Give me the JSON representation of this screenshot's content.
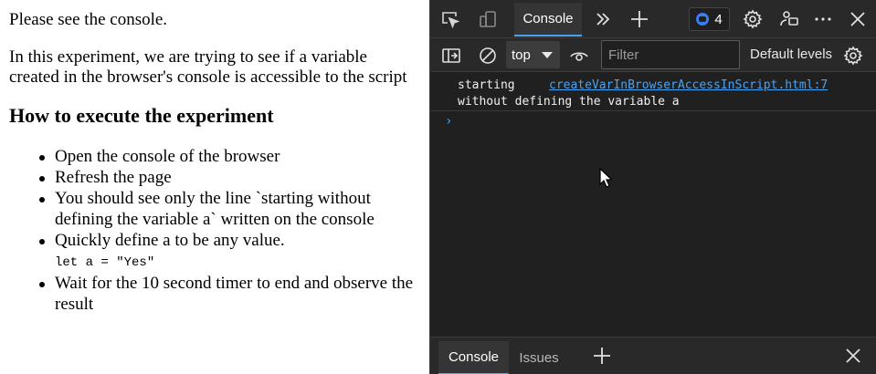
{
  "page": {
    "intro": "Please see the console.",
    "description": "In this experiment, we are trying to see if a variable created in the browser's console is accessible to the script",
    "heading": "How to execute the experiment",
    "steps": [
      "Open the console of the browser",
      "Refresh the page",
      "You should see only the line `starting without defining the variable a` written on the console",
      "Quickly define a to be any value.",
      "Wait for the 10 second timer to end and observe the result"
    ],
    "code": "let a = \"Yes\""
  },
  "devtools": {
    "topbar": {
      "tab_label": "Console",
      "issues_count": "4",
      "icons": [
        "inspect-icon",
        "device-toolbar-icon",
        "more-tabs-icon",
        "add-tab-icon",
        "issues-icon",
        "settings-icon",
        "feedback-icon",
        "more-options-icon",
        "close-icon"
      ]
    },
    "toolbar": {
      "context": "top",
      "filter_placeholder": "Filter",
      "levels_label": "Default levels"
    },
    "log": {
      "message": "starting\nwithout defining the variable a",
      "source": "createVarInBrowserAccessInScript.html:7"
    },
    "prompt": "›",
    "drawer": {
      "tabs": [
        "Console",
        "Issues"
      ]
    },
    "colors": {
      "background": "#202020",
      "panel": "#292929",
      "accent": "#4aa3f2"
    }
  }
}
